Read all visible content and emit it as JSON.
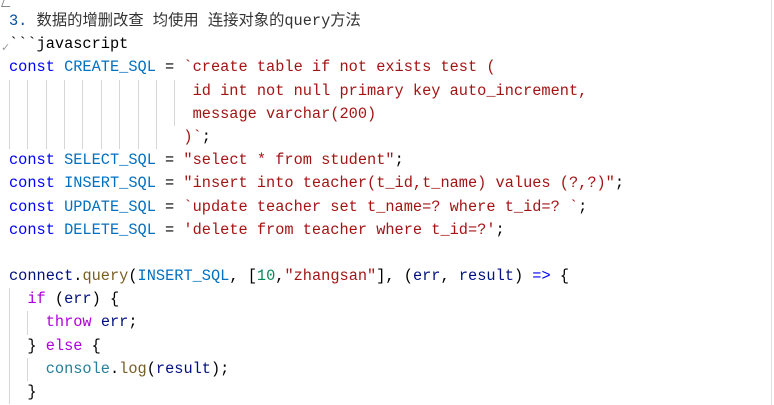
{
  "lines": [
    {
      "indent": 0,
      "tokens": [
        [
          "3. ",
          "t-head"
        ],
        [
          "数据的增删改查 均使用 连接对象的query方法",
          "t-headtext"
        ]
      ]
    },
    {
      "indent": 0,
      "tokens": [
        [
          "```javascript",
          "t-plain"
        ]
      ]
    },
    {
      "indent": 0,
      "tokens": [
        [
          "const ",
          "t-kw"
        ],
        [
          "CREATE_SQL",
          "t-const"
        ],
        [
          " = ",
          "t-plain"
        ],
        [
          "`create table if not exists test (",
          "t-str"
        ]
      ]
    },
    {
      "indent": 10,
      "tokens": [
        [
          "                    id int not null primary key auto_increment,",
          "t-str"
        ]
      ]
    },
    {
      "indent": 10,
      "tokens": [
        [
          "                    message varchar(200)",
          "t-str"
        ]
      ]
    },
    {
      "indent": 9,
      "tokens": [
        [
          "                   )`",
          "t-str"
        ],
        [
          ";",
          "t-plain"
        ]
      ]
    },
    {
      "indent": 0,
      "tokens": [
        [
          "const ",
          "t-kw"
        ],
        [
          "SELECT_SQL",
          "t-const"
        ],
        [
          " = ",
          "t-plain"
        ],
        [
          "\"select * from student\"",
          "t-str"
        ],
        [
          ";",
          "t-plain"
        ]
      ]
    },
    {
      "indent": 0,
      "tokens": [
        [
          "const ",
          "t-kw"
        ],
        [
          "INSERT_SQL",
          "t-const"
        ],
        [
          " = ",
          "t-plain"
        ],
        [
          "\"insert into teacher(t_id,t_name) values (?,?)\"",
          "t-str"
        ],
        [
          ";",
          "t-plain"
        ]
      ]
    },
    {
      "indent": 0,
      "tokens": [
        [
          "const ",
          "t-kw"
        ],
        [
          "UPDATE_SQL",
          "t-const"
        ],
        [
          " = ",
          "t-plain"
        ],
        [
          "`update teacher set t_name=? where t_id=? `",
          "t-str"
        ],
        [
          ";",
          "t-plain"
        ]
      ]
    },
    {
      "indent": 0,
      "tokens": [
        [
          "const ",
          "t-kw"
        ],
        [
          "DELETE_SQL",
          "t-const"
        ],
        [
          " = ",
          "t-plain"
        ],
        [
          "'delete from teacher where t_id=?'",
          "t-str"
        ],
        [
          ";",
          "t-plain"
        ]
      ]
    },
    {
      "indent": 0,
      "tokens": []
    },
    {
      "indent": 0,
      "tokens": [
        [
          "connect",
          "t-var"
        ],
        [
          ".",
          "t-plain"
        ],
        [
          "query",
          "t-fn"
        ],
        [
          "(",
          "t-plain"
        ],
        [
          "INSERT_SQL",
          "t-const"
        ],
        [
          ", [",
          "t-plain"
        ],
        [
          "10",
          "t-num"
        ],
        [
          ",",
          "t-plain"
        ],
        [
          "\"zhangsan\"",
          "t-str"
        ],
        [
          "], (",
          "t-plain"
        ],
        [
          "err",
          "t-var"
        ],
        [
          ", ",
          "t-plain"
        ],
        [
          "result",
          "t-var"
        ],
        [
          ") ",
          "t-plain"
        ],
        [
          "=>",
          "t-kw"
        ],
        [
          " {",
          "t-plain"
        ]
      ]
    },
    {
      "indent": 1,
      "tokens": [
        [
          "  ",
          "t-plain"
        ],
        [
          "if",
          "t-ctrl"
        ],
        [
          " (",
          "t-plain"
        ],
        [
          "err",
          "t-var"
        ],
        [
          ") {",
          "t-plain"
        ]
      ]
    },
    {
      "indent": 2,
      "tokens": [
        [
          "    ",
          "t-plain"
        ],
        [
          "throw",
          "t-ctrl"
        ],
        [
          " ",
          "t-plain"
        ],
        [
          "err",
          "t-var"
        ],
        [
          ";",
          "t-plain"
        ]
      ]
    },
    {
      "indent": 1,
      "tokens": [
        [
          "  } ",
          "t-plain"
        ],
        [
          "else",
          "t-ctrl"
        ],
        [
          " {",
          "t-plain"
        ]
      ]
    },
    {
      "indent": 2,
      "tokens": [
        [
          "    ",
          "t-plain"
        ],
        [
          "console",
          "t-cls"
        ],
        [
          ".",
          "t-plain"
        ],
        [
          "log",
          "t-fn"
        ],
        [
          "(",
          "t-plain"
        ],
        [
          "result",
          "t-var"
        ],
        [
          ");",
          "t-plain"
        ]
      ]
    },
    {
      "indent": 1,
      "tokens": [
        [
          "  }",
          "t-plain"
        ]
      ]
    }
  ]
}
